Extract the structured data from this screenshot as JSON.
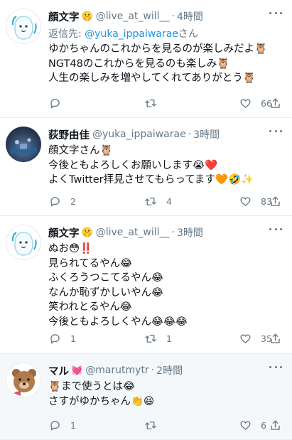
{
  "tweets": [
    {
      "name": "顔文字",
      "name_emoji": "🤫",
      "handle": "@live_at_will__",
      "time": "4時間",
      "reply_label": "返信先:",
      "reply_mention": "@yuka_ippaiwarae",
      "reply_suffix": "さん",
      "lines": [
        "ゆかちゃんのこれからを見るのが楽しみだよ🦉",
        "NGT48のこれからを見るのも楽しみ🦉",
        "人生の楽しみを増やしてくれてありがとう🦉"
      ],
      "replies": "",
      "retweets": "",
      "likes": "66"
    },
    {
      "name": "荻野由佳",
      "name_emoji": "",
      "handle": "@yuka_ippaiwarae",
      "time": "3時間",
      "lines": [
        "顔文字さん🦉",
        "今後ともよろしくお願いします😭❤️",
        "よくTwitter拝見させてもらってます🧡🤣✨"
      ],
      "replies": "2",
      "retweets": "4",
      "likes": "83"
    },
    {
      "name": "顔文字",
      "name_emoji": "🤫",
      "handle": "@live_at_will__",
      "time": "3時間",
      "lines": [
        "ぬお😳‼️",
        "見られてるやん😂",
        "ふくろうつこてるやん😂",
        "なんか恥ずかしいやん😂",
        "笑われとるやん😂",
        "今後ともよろしくやん😂😂😂"
      ],
      "replies": "1",
      "retweets": "1",
      "likes": "35"
    },
    {
      "name": "マル",
      "name_emoji": "💓",
      "handle": "@marutmytr",
      "time": "2時間",
      "lines": [
        "🦉まで使うとは😂",
        "さすがゆかちゃん👏😆"
      ],
      "replies": "1",
      "retweets": "",
      "likes": "6"
    }
  ],
  "separator": "·"
}
